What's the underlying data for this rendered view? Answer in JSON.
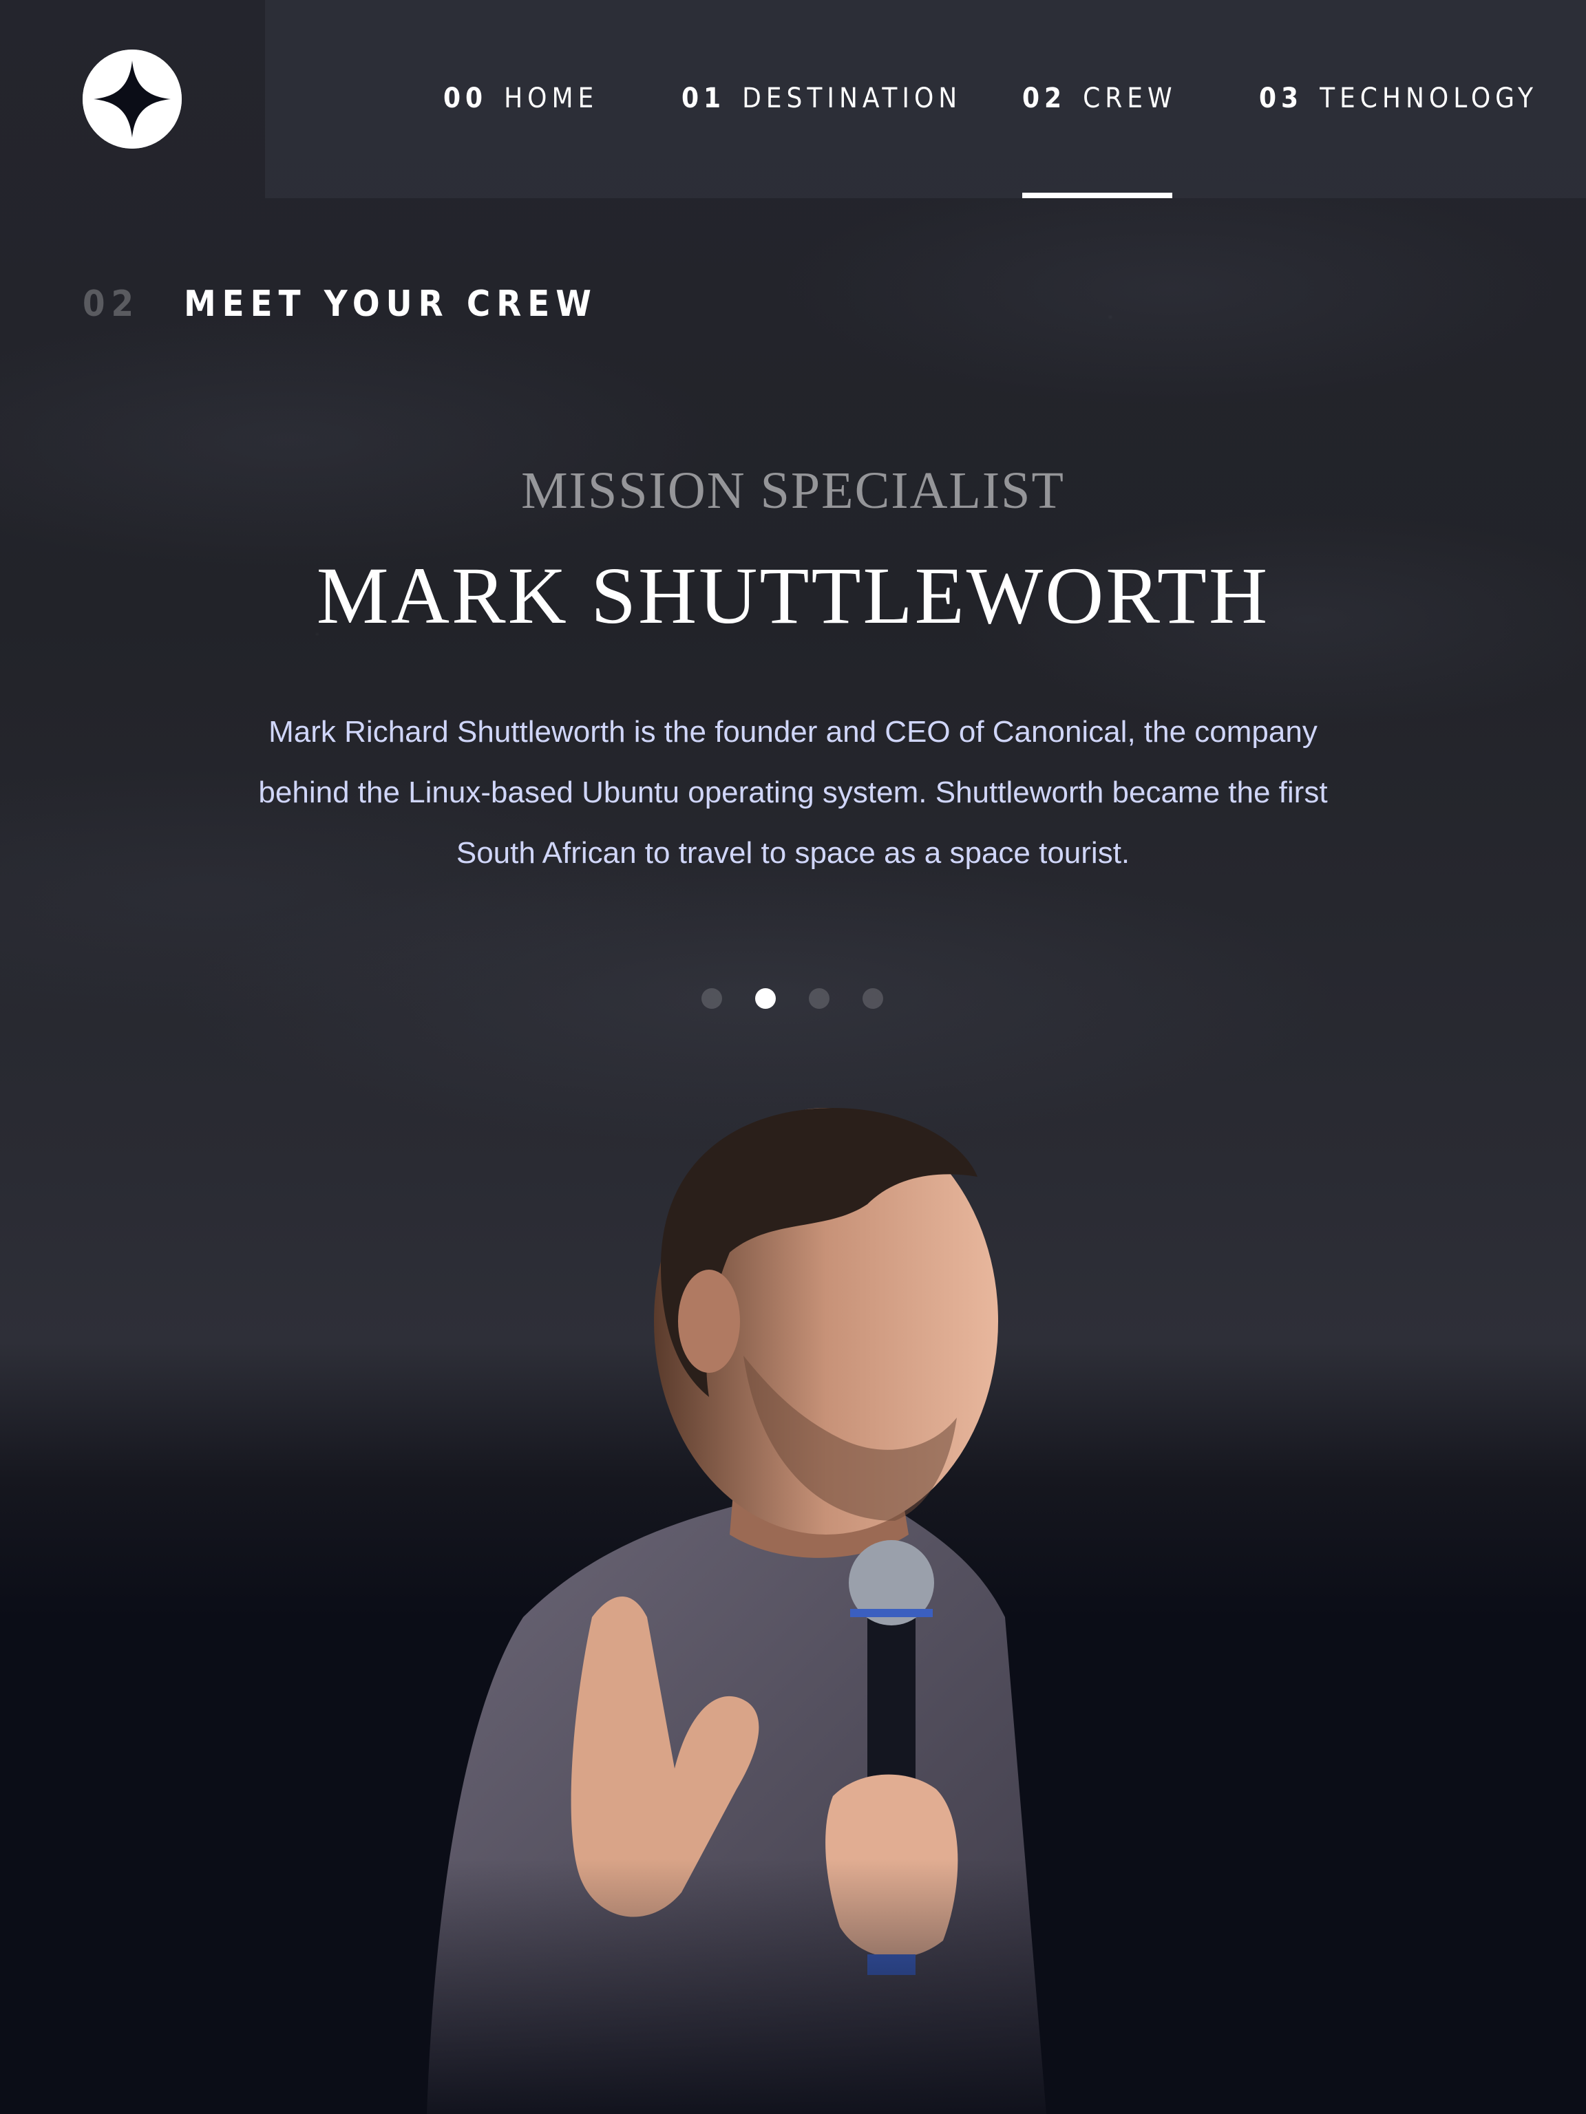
{
  "nav": {
    "items": [
      {
        "num": "00",
        "label": "HOME",
        "active": false
      },
      {
        "num": "01",
        "label": "DESTINATION",
        "active": false
      },
      {
        "num": "02",
        "label": "CREW",
        "active": true
      },
      {
        "num": "03",
        "label": "TECHNOLOGY",
        "active": false
      }
    ]
  },
  "page": {
    "heading_num": "02",
    "heading": "MEET YOUR CREW"
  },
  "crew": {
    "role": "MISSION SPECIALIST",
    "name": "MARK SHUTTLEWORTH",
    "bio": "Mark Richard Shuttleworth is the founder and CEO of Canonical, the company behind the Linux-based Ubuntu operating system. Shuttleworth became the first South African to travel to space as a space tourist.",
    "slide_count": 4,
    "active_slide_index": 1
  },
  "colors": {
    "background": "#0b0d17",
    "nav_background": "#2e2f38",
    "text": "#ffffff",
    "bio_text": "#d0d6f9"
  },
  "icons": {
    "logo": "four-point-star-logo",
    "photo": "crew-member-photo"
  }
}
